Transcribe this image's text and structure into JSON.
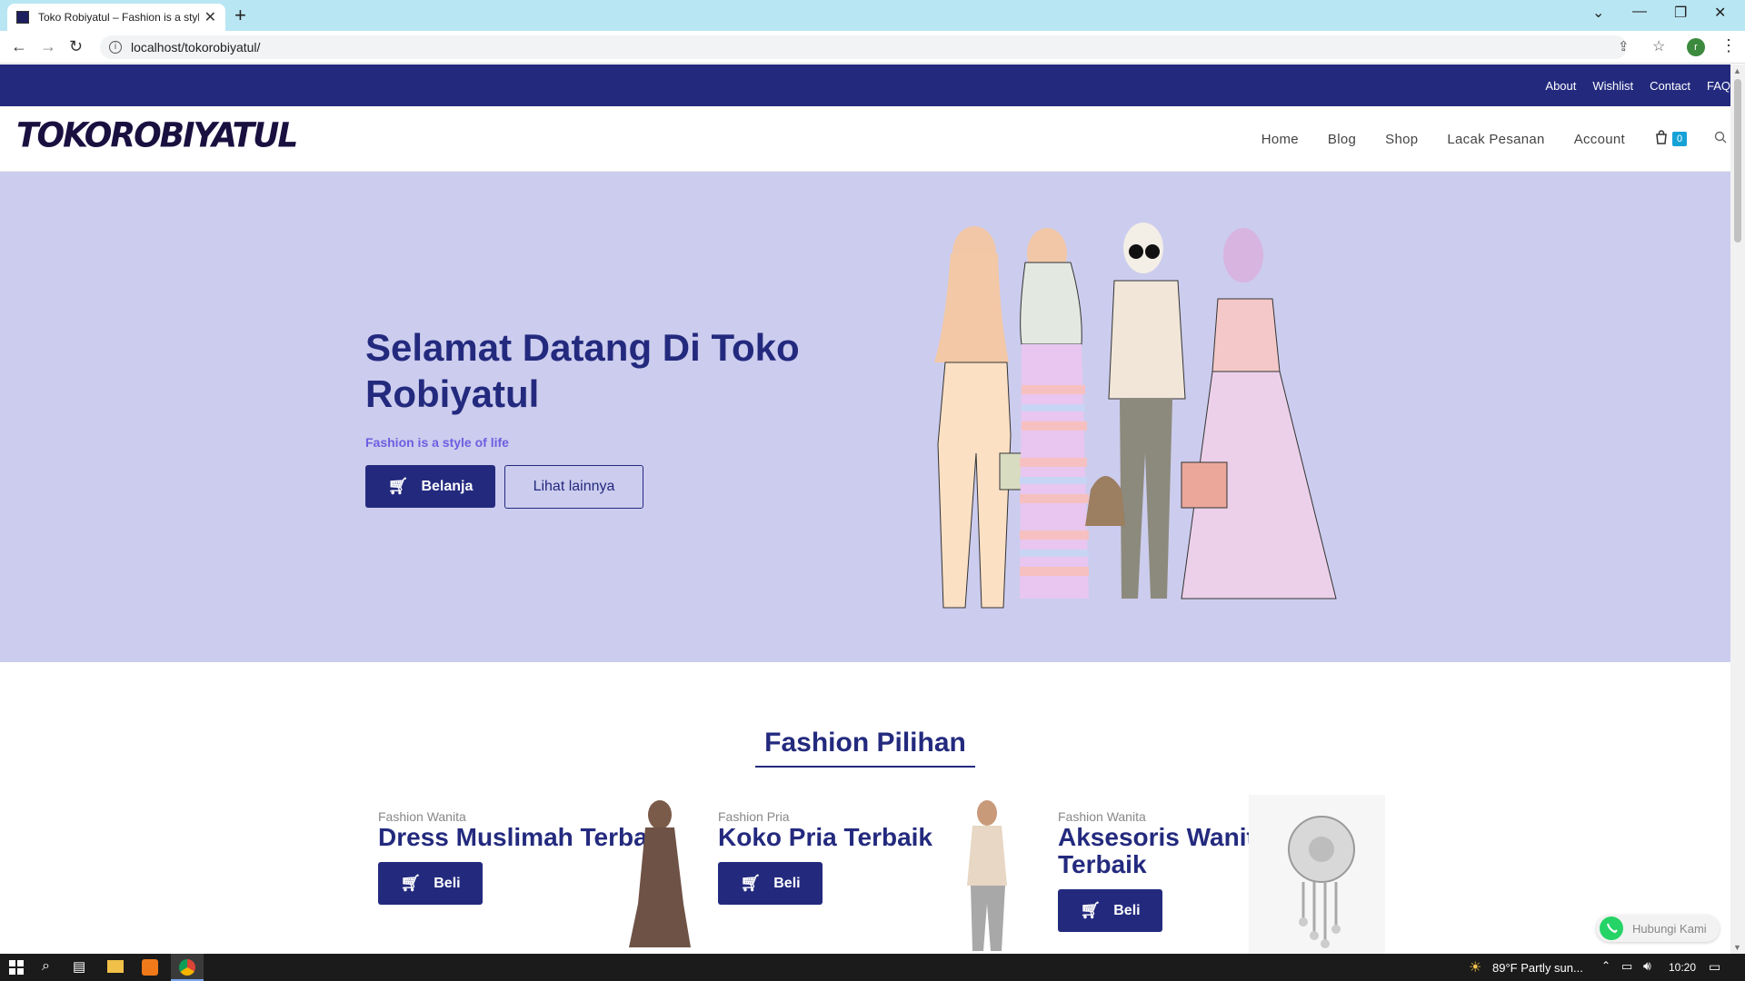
{
  "browser": {
    "tab_title": "Toko Robiyatul – Fashion is a style of life",
    "url": "localhost/tokorobiyatul/"
  },
  "topbar": {
    "links": [
      "About",
      "Wishlist",
      "Contact",
      "FAQ"
    ]
  },
  "header": {
    "logo": "TOKOROBIYATUL",
    "nav": [
      "Home",
      "Blog",
      "Shop",
      "Lacak Pesanan",
      "Account"
    ],
    "cart_count": "0"
  },
  "hero": {
    "title": "Selamat Datang Di Toko Robiyatul",
    "tagline": "Fashion is a style of life",
    "primary_button": "Belanja",
    "secondary_button": "Lihat lainnya"
  },
  "featured": {
    "title": "Fashion Pilihan",
    "cards": [
      {
        "category": "Fashion Wanita",
        "title": "Dress Muslimah Terbaik",
        "button": "Beli"
      },
      {
        "category": "Fashion Pria",
        "title": "Koko Pria Terbaik",
        "button": "Beli"
      },
      {
        "category": "Fashion Wanita",
        "title": "Aksesoris Wanita Terbaik",
        "button": "Beli"
      }
    ]
  },
  "whatsapp": {
    "label": "Hubungi Kami"
  },
  "taskbar": {
    "weather": "89°F  Partly sun...",
    "time": "10:20"
  },
  "colors": {
    "primary": "#232a7e",
    "hero_bg": "#ccccee",
    "accent": "#6f5de0",
    "badge": "#16a2d6"
  }
}
